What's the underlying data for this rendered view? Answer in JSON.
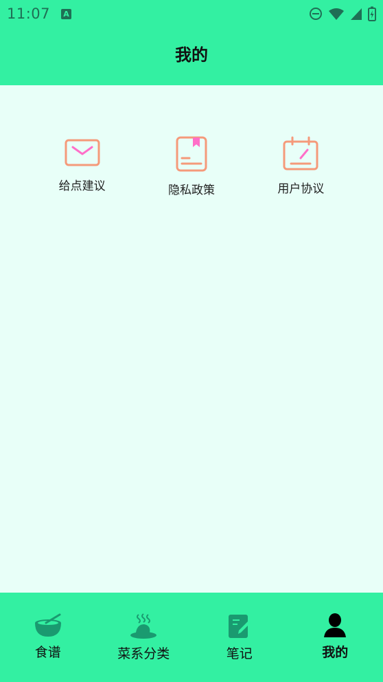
{
  "status_bar": {
    "time": "11:07",
    "badge": "A"
  },
  "header": {
    "title": "我的"
  },
  "menu": {
    "items": [
      {
        "label": "给点建议",
        "icon": "envelope-icon"
      },
      {
        "label": "隐私政策",
        "icon": "book-icon"
      },
      {
        "label": "用户协议",
        "icon": "calendar-edit-icon"
      }
    ]
  },
  "bottom_nav": {
    "items": [
      {
        "label": "食谱",
        "icon": "bowl-icon"
      },
      {
        "label": "菜系分类",
        "icon": "dish-icon"
      },
      {
        "label": "笔记",
        "icon": "note-edit-icon"
      },
      {
        "label": "我的",
        "icon": "person-icon",
        "active": true
      }
    ]
  },
  "colors": {
    "accent": "#33f0a2",
    "background": "#e8fff8",
    "menu_icon_stroke": "#f59a7a",
    "menu_icon_accent": "#ff6fc8",
    "nav_icon": "#1a9a70"
  }
}
